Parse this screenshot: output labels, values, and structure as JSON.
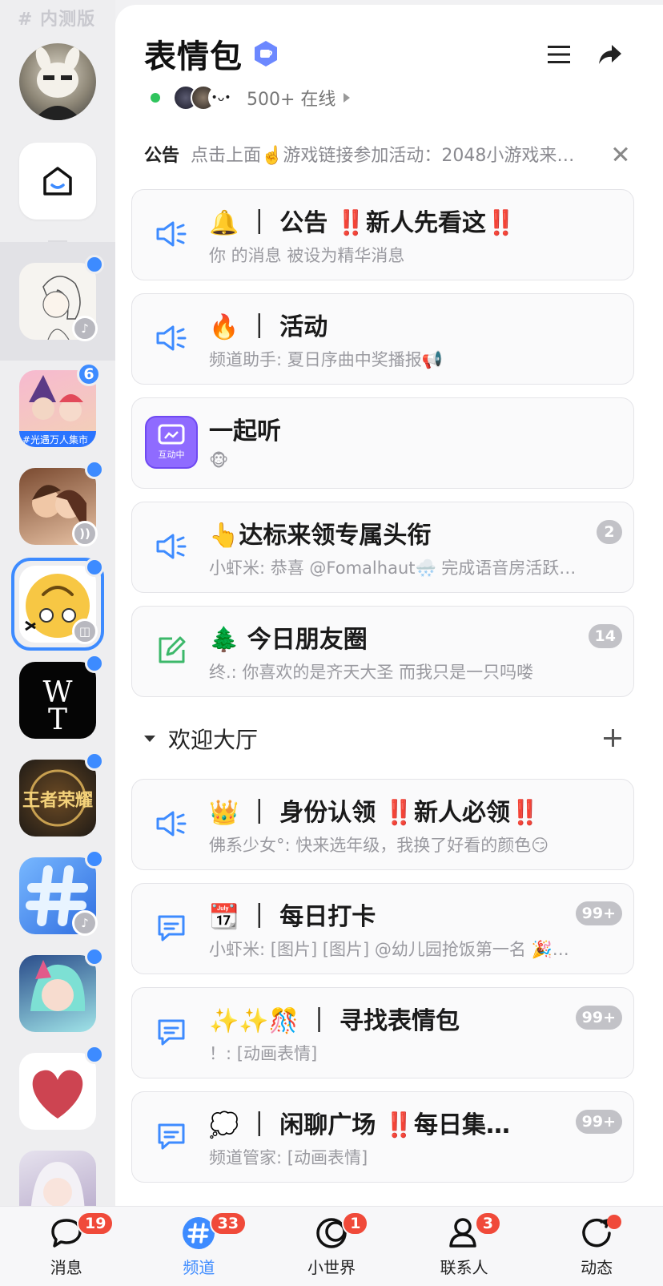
{
  "rail": {
    "beta_label": "# 内测版",
    "guilds": [
      {
        "id": "sketch-girl",
        "dot": true,
        "sub_icon": "music-note-icon"
      },
      {
        "id": "guang-yu",
        "badge": "6",
        "label": "#光遇万人集市"
      },
      {
        "id": "couple-art",
        "dot": true,
        "sub_icon": "voice-waves-icon"
      },
      {
        "id": "emoji-face",
        "dot": true,
        "sub_icon": "game-controller-icon",
        "active": true
      },
      {
        "id": "wt-logo",
        "dot": true,
        "logo_text": "WT"
      },
      {
        "id": "wangzhe",
        "dot": true,
        "logo_text": "王者荣耀"
      },
      {
        "id": "hash-blue",
        "dot": true,
        "sub_icon": "music-note-icon"
      },
      {
        "id": "anime-girl",
        "dot": true
      },
      {
        "id": "blurred-heart",
        "dot": true
      },
      {
        "id": "anime-girl-2"
      }
    ]
  },
  "header": {
    "title": "表情包",
    "online_text": "500+ 在线"
  },
  "notice": {
    "label": "公告",
    "text": "点击上面☝️游戏链接参加活动：2048小游戏来…"
  },
  "channels_top": [
    {
      "title_pre": "🔔 ｜ 公告 ",
      "title_bang": "‼️",
      "title_mid": "新人先看这",
      "title_bang2": "‼️",
      "sub": "你 的消息 被设为精华消息",
      "icon": "announcement-speaker-icon"
    },
    {
      "title_pre": "🔥 ｜ 活动",
      "sub": "频道助手: 夏日序曲中奖播报📢",
      "icon": "announcement-speaker-icon"
    },
    {
      "title_pre": "一起听",
      "sub": "🐵",
      "icon": "listen-together-icon",
      "tag": "互动中"
    },
    {
      "title_pre": "👆达标来领专属头衔",
      "sub": "小虾米: 恭喜 @Fomalhaut🌨️ 完成语音房活跃…",
      "badge": "2",
      "icon": "announcement-speaker-icon"
    },
    {
      "title_pre": "🌲 今日朋友圈",
      "sub": "终.: 你喜欢的是齐天大圣 而我只是一只吗喽",
      "badge": "14",
      "icon": "post-edit-icon"
    }
  ],
  "section": {
    "title": "欢迎大厅"
  },
  "channels_hall": [
    {
      "title_pre": "👑 ｜ 身份认领 ",
      "title_bang": "‼️",
      "title_mid": "新人必领",
      "title_bang2": "‼️",
      "sub": "佛系少女°: 快来选年级，我换了好看的颜色😏",
      "icon": "announcement-speaker-icon"
    },
    {
      "title_pre": "📆 ｜ 每日打卡",
      "sub": "小虾米: [图片] [图片] @幼儿园抢饭第一名 🎉…",
      "badge": "99+",
      "icon": "chat-bubble-icon"
    },
    {
      "title_pre": "✨✨🎊 ｜ 寻找表情包",
      "sub": "！: [动画表情]",
      "badge": "99+",
      "icon": "chat-bubble-icon"
    },
    {
      "title_pre": "💭 ｜ 闲聊广场 ",
      "title_bang": "‼️",
      "title_mid": "每日集…",
      "sub": "频道管家: [动画表情]",
      "badge": "99+",
      "icon": "chat-bubble-icon"
    }
  ],
  "tabs": [
    {
      "label": "消息",
      "badge": "19",
      "icon": "message-bubble-icon"
    },
    {
      "label": "频道",
      "badge": "33",
      "icon": "channel-hash-icon",
      "active": true
    },
    {
      "label": "小世界",
      "badge": "1",
      "icon": "small-world-icon"
    },
    {
      "label": "联系人",
      "badge": "3",
      "icon": "contacts-icon"
    },
    {
      "label": "动态",
      "dot": true,
      "icon": "moments-icon"
    }
  ],
  "colors": {
    "accent": "#3d8bff",
    "badge_red": "#f04a3a",
    "online_green": "#2fc45d",
    "listen_purple": "#8f6bff"
  }
}
